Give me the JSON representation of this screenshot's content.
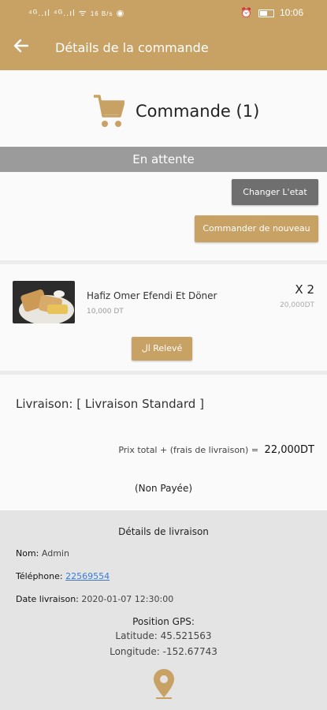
{
  "status_bar": {
    "signal_text": "⁴ᴳ..ıl ⁴ᴳ..ıl ᯤ",
    "network_speed": "16 B/s",
    "time": "10:06"
  },
  "app_bar": {
    "back_icon": "arrow-left-icon",
    "title": "Détails de la commande"
  },
  "order": {
    "cart_icon": "cart-icon",
    "label": "Commande (1)",
    "status": "En attente"
  },
  "actions": {
    "change_state": "Changer L'etat",
    "reorder": "Commander de nouveau"
  },
  "item": {
    "name": "Hafiz Omer Efendi Et Döner",
    "unit_price": "10,000 DT",
    "quantity": "X 2",
    "line_total": "20,000DT",
    "button": "ال Relevé"
  },
  "delivery": {
    "mode": "Livraison: [ Livraison Standard ]",
    "total_label": "Prix total + (frais de livraison) =",
    "total_amount": "22,000DT",
    "payment_status": "(Non Payée)"
  },
  "details": {
    "title": "Détails de livraison",
    "name_label": "Nom:",
    "name_value": "Admin",
    "phone_label": "Téléphone:",
    "phone_value": "22569554",
    "date_label": "Date livraison:",
    "date_value": "2020-01-07 12:30:00",
    "gps_title": "Position GPS:",
    "latitude": "Latitude: 45.521563",
    "longitude": "Longitude: -152.67743",
    "pin_icon": "location-pin-icon"
  },
  "colors": {
    "accent": "#c8a265",
    "status_strip": "#9b9b9b",
    "button_grey": "#6f6f6f",
    "link": "#3b7bd8"
  }
}
